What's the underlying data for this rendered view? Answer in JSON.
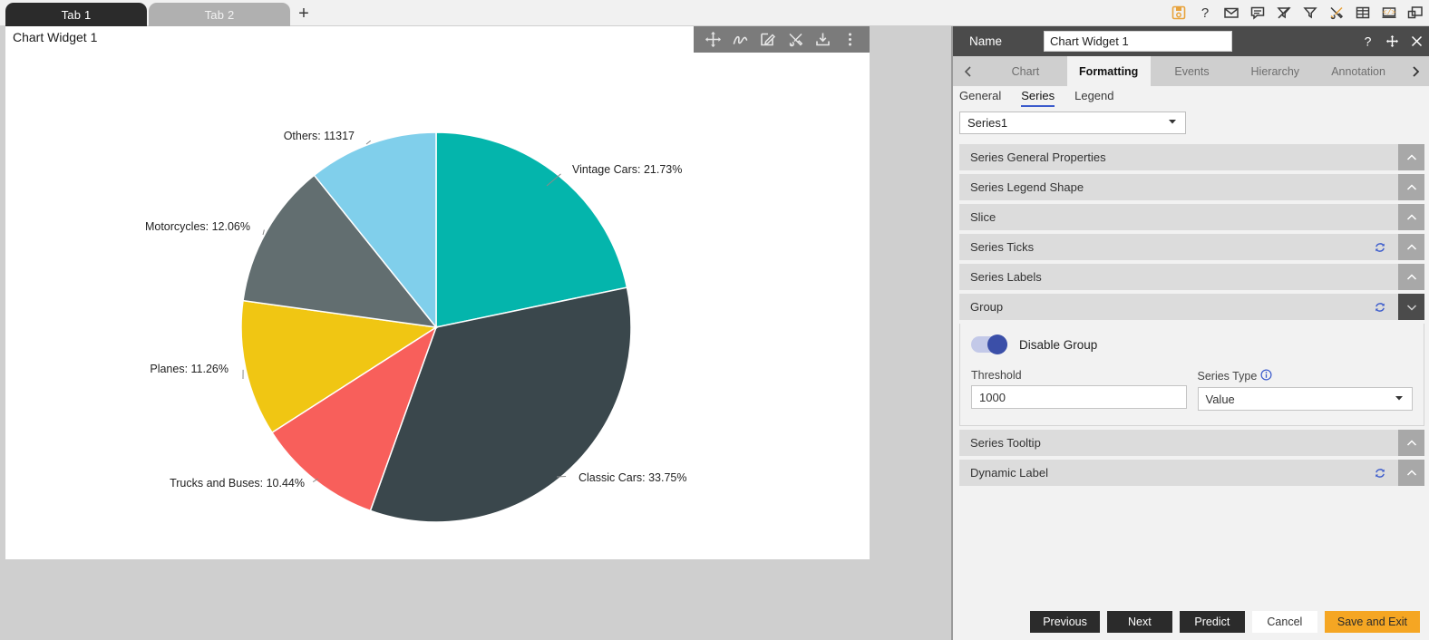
{
  "top_bar": {
    "tabs": [
      {
        "label": "Tab 1",
        "active": true
      },
      {
        "label": "Tab 2",
        "active": false
      }
    ],
    "add_tab_label": "+",
    "icons": [
      {
        "name": "save-disk-icon",
        "glyph": "save"
      },
      {
        "name": "help-question-icon",
        "glyph": "question"
      },
      {
        "name": "mail-envelope-icon",
        "glyph": "envelope"
      },
      {
        "name": "comment-bubble-icon",
        "glyph": "comment"
      },
      {
        "name": "filter-off-icon",
        "glyph": "filter-off"
      },
      {
        "name": "filter-icon",
        "glyph": "filter"
      },
      {
        "name": "tools-icon",
        "glyph": "tools"
      },
      {
        "name": "table-grid-icon",
        "glyph": "table"
      },
      {
        "name": "code-window-icon",
        "glyph": "code"
      },
      {
        "name": "layout-panel-icon",
        "glyph": "layout"
      }
    ]
  },
  "widget": {
    "title": "Chart Widget 1",
    "toolbar_icons": [
      {
        "name": "move-icon",
        "glyph": "move"
      },
      {
        "name": "scribble-icon",
        "glyph": "scribble"
      },
      {
        "name": "edit-pencil-icon",
        "glyph": "edit"
      },
      {
        "name": "tools-icon",
        "glyph": "tools"
      },
      {
        "name": "download-icon",
        "glyph": "download"
      },
      {
        "name": "more-options-icon",
        "glyph": "kebab"
      }
    ]
  },
  "chart_data": {
    "type": "pie",
    "title": "",
    "categories": [
      "Vintage Cars",
      "Classic Cars",
      "Trucks and Buses",
      "Planes",
      "Motorcycles",
      "Others"
    ],
    "values": [
      21.73,
      33.75,
      10.44,
      11.26,
      12.06,
      10.76
    ],
    "labels": [
      "Vintage Cars: 21.73%",
      "Classic Cars: 33.75%",
      "Trucks and Buses: 10.44%",
      "Planes: 11.26%",
      "Motorcycles: 12.06%",
      "Others: 11317"
    ],
    "colors": [
      "#04b5ac",
      "#3a474c",
      "#f85f5b",
      "#f0c613",
      "#626e70",
      "#80cfeb"
    ],
    "others_raw_value": 11317,
    "legend_position": "none",
    "grid": false
  },
  "panel": {
    "name_label": "Name",
    "name_value": "Chart Widget 1",
    "header_icons": [
      {
        "name": "help-question-icon",
        "glyph": "question"
      },
      {
        "name": "move-icon",
        "glyph": "move"
      },
      {
        "name": "close-icon",
        "glyph": "close"
      }
    ],
    "tabs": [
      {
        "label": "Chart",
        "active": false
      },
      {
        "label": "Formatting",
        "active": true
      },
      {
        "label": "Events",
        "active": false
      },
      {
        "label": "Hierarchy",
        "active": false
      },
      {
        "label": "Annotation",
        "active": false
      }
    ],
    "subtabs": [
      {
        "label": "General",
        "active": false
      },
      {
        "label": "Series",
        "active": true
      },
      {
        "label": "Legend",
        "active": false
      }
    ],
    "series_select": {
      "value": "Series1"
    },
    "sections": [
      {
        "label": "Series General Properties",
        "expanded": false,
        "refresh": false
      },
      {
        "label": "Series Legend Shape",
        "expanded": false,
        "refresh": false
      },
      {
        "label": "Slice",
        "expanded": false,
        "refresh": false
      },
      {
        "label": "Series Ticks",
        "expanded": false,
        "refresh": true
      },
      {
        "label": "Series Labels",
        "expanded": false,
        "refresh": false
      },
      {
        "label": "Group",
        "expanded": true,
        "refresh": true
      }
    ],
    "sections_after": [
      {
        "label": "Series Tooltip",
        "expanded": false,
        "refresh": false
      },
      {
        "label": "Dynamic Label",
        "expanded": false,
        "refresh": true
      }
    ],
    "group": {
      "toggle_label": "Disable Group",
      "toggle_on": true,
      "threshold_label": "Threshold",
      "threshold_value": "1000",
      "series_type_label": "Series Type",
      "series_type_value": "Value"
    }
  },
  "footer": {
    "buttons": [
      {
        "label": "Previous",
        "style": "dark"
      },
      {
        "label": "Next",
        "style": "dark"
      },
      {
        "label": "Predict",
        "style": "dark"
      },
      {
        "label": "Cancel",
        "style": "light"
      },
      {
        "label": "Save and Exit",
        "style": "accent"
      }
    ]
  }
}
